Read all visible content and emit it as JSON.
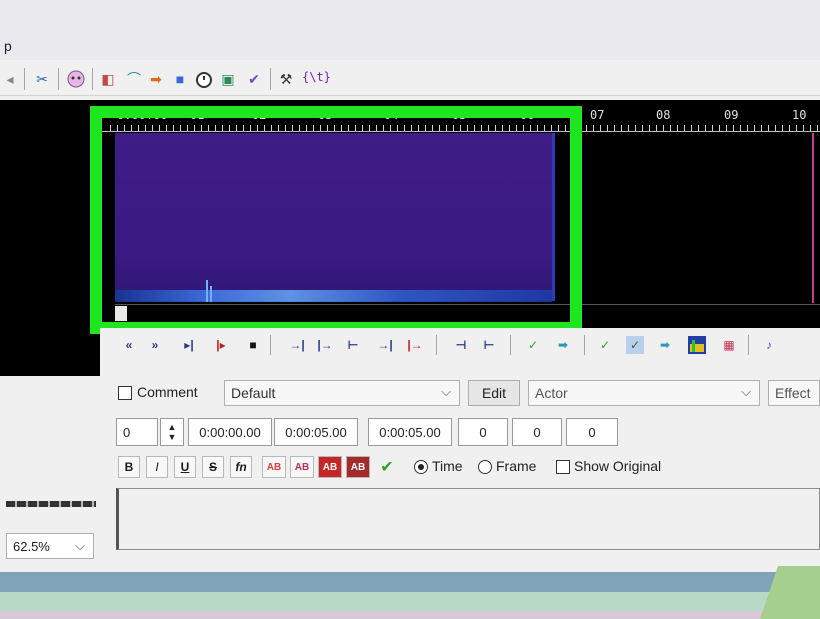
{
  "title_fragment": "p",
  "toolbar": {
    "icons": [
      "scissors-icon",
      "addon-icon",
      "face-icon",
      "subtitle-icon",
      "import-icon",
      "arrow-icon",
      "stop-icon",
      "timer-icon",
      "save-icon",
      "spell-check-icon",
      "tools-icon"
    ],
    "style_override_text": "{\\t}"
  },
  "timeline": {
    "ruler_labels": [
      "0:00:00",
      "01",
      "02",
      "03",
      "04",
      "05",
      "06",
      "07",
      "08",
      "09",
      "10"
    ]
  },
  "controls": {
    "icons": [
      "rewind-icon",
      "forward-icon",
      "play-selection-icon",
      "play-line-icon",
      "stop-icon",
      "snap-start-icon",
      "snap-end-icon",
      "play-before-icon",
      "play-after-icon",
      "play-to-end-icon",
      "shift-left-icon",
      "shift-right-icon",
      "commit-icon",
      "next-line-icon",
      "auto-commit-icon",
      "auto-scroll-icon",
      "auto-next-icon",
      "spectrum-icon",
      "video-icon",
      "karaoke-icon"
    ]
  },
  "edit": {
    "comment_label": "Comment",
    "style_value": "Default",
    "edit_label": "Edit",
    "actor_placeholder": "Actor",
    "effect_placeholder": "Effect",
    "layer_value": "0",
    "start_time": "0:00:00.00",
    "end_time": "0:00:05.00",
    "duration": "0:00:05.00",
    "margin_left": "0",
    "margin_right": "0",
    "margin_vertical": "0",
    "format_buttons": [
      "B",
      "I",
      "U",
      "S",
      "fn",
      "AB",
      "AB",
      "AB",
      "AB"
    ],
    "time_label": "Time",
    "frame_label": "Frame",
    "show_original_label": "Show Original"
  },
  "video": {
    "zoom_value": "62.5%"
  },
  "colors": {
    "highlight": "#1ee51e",
    "spectrum": "#3f1c86",
    "ab_primary": "#e53b3b",
    "ab_secondary": "#c02d5a",
    "ab_outline": "#c62626",
    "ab_shadow": "#a52a2a",
    "commit_check": "#2ea02e"
  }
}
